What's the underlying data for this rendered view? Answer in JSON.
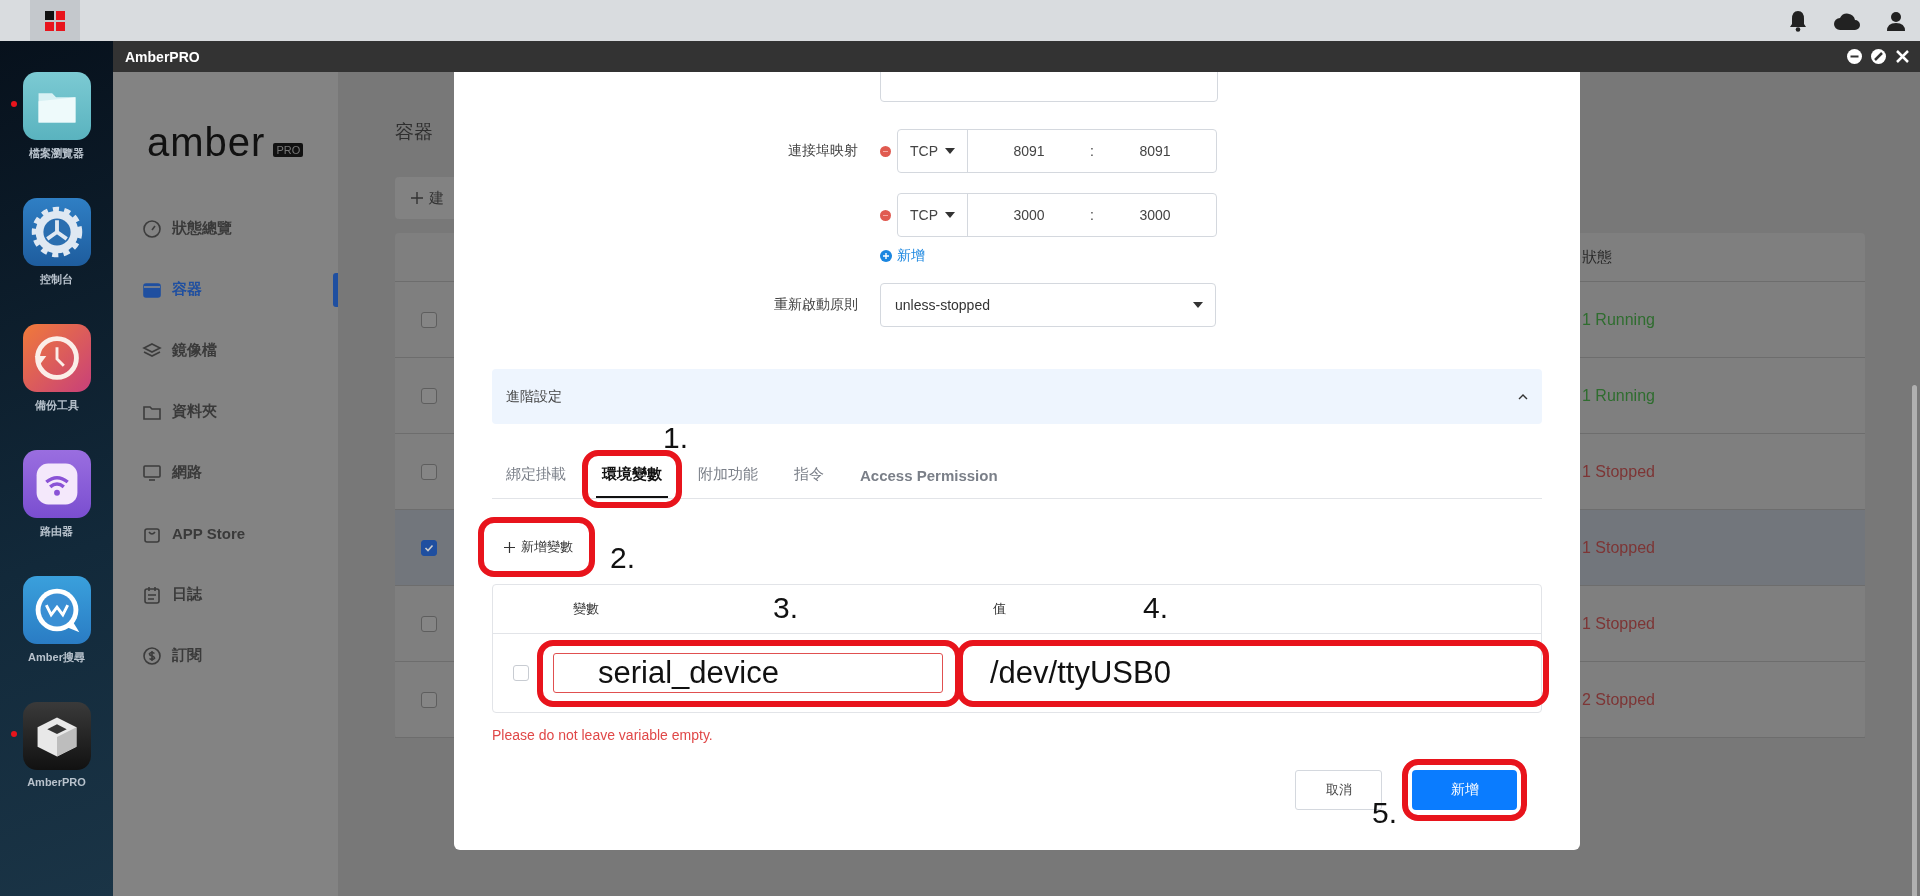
{
  "dock": {
    "apps": [
      {
        "label": "檔案瀏覽器",
        "running": true
      },
      {
        "label": "控制台",
        "running": false
      },
      {
        "label": "備份工具",
        "running": false
      },
      {
        "label": "路由器",
        "running": false
      },
      {
        "label": "Amber搜尋",
        "running": false
      },
      {
        "label": "AmberPRO",
        "running": true
      }
    ]
  },
  "window": {
    "title": "AmberPRO"
  },
  "sidebar": {
    "logo": "amber",
    "logo_badge": "PRO",
    "items": [
      {
        "label": "狀態總覽",
        "selected": false
      },
      {
        "label": "容器",
        "selected": true
      },
      {
        "label": "鏡像檔",
        "selected": false
      },
      {
        "label": "資料夾",
        "selected": false
      },
      {
        "label": "網路",
        "selected": false
      },
      {
        "label": "APP Store",
        "selected": false
      },
      {
        "label": "日誌",
        "selected": false
      },
      {
        "label": "訂閱",
        "selected": false
      }
    ]
  },
  "page": {
    "title": "容器",
    "create_button": "建",
    "table": {
      "columns": [
        "狀態"
      ],
      "rows": [
        {
          "checked": false,
          "status": "1 Running",
          "kind": "running"
        },
        {
          "checked": false,
          "status": "1 Running",
          "kind": "running"
        },
        {
          "checked": false,
          "status": "1 Stopped",
          "kind": "stopped"
        },
        {
          "checked": true,
          "status": "1 Stopped",
          "kind": "stopped"
        },
        {
          "checked": false,
          "status": "1 Stopped",
          "kind": "stopped"
        },
        {
          "checked": false,
          "status": "2 Stopped",
          "kind": "stopped"
        }
      ]
    }
  },
  "dialog": {
    "ports_label": "連接埠映射",
    "port_mappings": [
      {
        "protocol": "TCP",
        "host": "8091",
        "separator": ":",
        "container": "8091"
      },
      {
        "protocol": "TCP",
        "host": "3000",
        "separator": ":",
        "container": "3000"
      }
    ],
    "add_port": "新增",
    "restart_label": "重新啟動原則",
    "restart_policy": "unless-stopped",
    "advanced": {
      "title": "進階設定",
      "expanded": true
    },
    "tabs": [
      {
        "label": "綁定掛載",
        "selected": false
      },
      {
        "label": "環境變數",
        "selected": true
      },
      {
        "label": "附加功能",
        "selected": false
      },
      {
        "label": "指令",
        "selected": false
      },
      {
        "label": "Access Permission",
        "selected": false
      }
    ],
    "add_variable": "新增變數",
    "variables": {
      "columns": [
        "變數",
        "值"
      ],
      "rows": [
        {
          "checked": false,
          "name": "serial_device",
          "value": "/dev/ttyUSB0",
          "invalid": true
        }
      ]
    },
    "error": "Please do not leave variable empty.",
    "cancel": "取消",
    "submit": "新增",
    "annotations": [
      {
        "number": "1."
      },
      {
        "number": "2."
      },
      {
        "number": "3."
      },
      {
        "number": "4."
      },
      {
        "number": "5."
      }
    ]
  }
}
